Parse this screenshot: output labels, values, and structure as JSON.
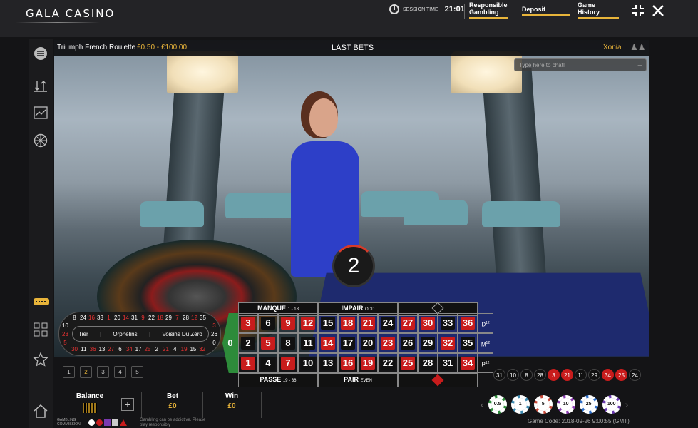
{
  "header": {
    "logo": "GALA CASINO",
    "session_label": "SESSION TIME",
    "session_time": "21:01",
    "links": [
      {
        "line1": "Responsible",
        "line2": "Gambling"
      },
      {
        "line1": "Deposit",
        "line2": ""
      },
      {
        "line1": "Game",
        "line2": "History"
      }
    ],
    "icons": [
      "fullscreen-icon",
      "close-icon"
    ]
  },
  "sidebar": {
    "icons": [
      "menu-icon",
      "sort-icon",
      "chart-icon",
      "wheel-icon",
      "chip-stack-icon",
      "grid-icon",
      "star-icon",
      "home-icon"
    ]
  },
  "stage": {
    "game_name": "Triumph French Roulette",
    "limits": "£0.50 - £100.00",
    "last_bets": "LAST BETS",
    "dealer_name": "Xonia",
    "chat_placeholder": "Type here to chat!",
    "timer": "2"
  },
  "racetrack": {
    "top": [
      "8",
      "24",
      "16",
      "33",
      "1",
      "20",
      "14",
      "31",
      "9",
      "22",
      "18",
      "29",
      "7",
      "28",
      "12",
      "35"
    ],
    "bottom": [
      "30",
      "11",
      "36",
      "13",
      "27",
      "6",
      "34",
      "17",
      "25",
      "2",
      "21",
      "4",
      "19",
      "15",
      "32"
    ],
    "left": [
      "10",
      "23",
      "5"
    ],
    "right": [
      "3",
      "26",
      "0"
    ],
    "sections": [
      "Tier",
      "Orphelins",
      "Voisins Du Zero"
    ]
  },
  "recent_buttons": [
    "1",
    "2",
    "3",
    "4",
    "5"
  ],
  "betting_table": {
    "zero": "0",
    "top": [
      {
        "main": "MANQUE",
        "sub": "1 - 18"
      },
      {
        "main": "IMPAIR",
        "sub": "ODD"
      },
      {
        "main": "",
        "sub": ""
      }
    ],
    "bottom": [
      {
        "main": "PASSE",
        "sub": "19 - 36"
      },
      {
        "main": "PAIR",
        "sub": "EVEN"
      },
      {
        "main": "",
        "sub": ""
      }
    ],
    "rows": [
      [
        {
          "n": "3",
          "c": "red"
        },
        {
          "n": "6",
          "c": "black"
        },
        {
          "n": "9",
          "c": "red"
        },
        {
          "n": "12",
          "c": "red"
        },
        {
          "n": "15",
          "c": "black"
        },
        {
          "n": "18",
          "c": "red"
        },
        {
          "n": "21",
          "c": "red"
        },
        {
          "n": "24",
          "c": "black"
        },
        {
          "n": "27",
          "c": "red"
        },
        {
          "n": "30",
          "c": "red"
        },
        {
          "n": "33",
          "c": "black"
        },
        {
          "n": "36",
          "c": "red"
        }
      ],
      [
        {
          "n": "2",
          "c": "black"
        },
        {
          "n": "5",
          "c": "red"
        },
        {
          "n": "8",
          "c": "black"
        },
        {
          "n": "11",
          "c": "black"
        },
        {
          "n": "14",
          "c": "red"
        },
        {
          "n": "17",
          "c": "black"
        },
        {
          "n": "20",
          "c": "black"
        },
        {
          "n": "23",
          "c": "red"
        },
        {
          "n": "26",
          "c": "black"
        },
        {
          "n": "29",
          "c": "black"
        },
        {
          "n": "32",
          "c": "red"
        },
        {
          "n": "35",
          "c": "black"
        }
      ],
      [
        {
          "n": "1",
          "c": "red"
        },
        {
          "n": "4",
          "c": "black"
        },
        {
          "n": "7",
          "c": "red"
        },
        {
          "n": "10",
          "c": "black"
        },
        {
          "n": "13",
          "c": "black"
        },
        {
          "n": "16",
          "c": "red"
        },
        {
          "n": "19",
          "c": "red"
        },
        {
          "n": "22",
          "c": "black"
        },
        {
          "n": "25",
          "c": "red"
        },
        {
          "n": "28",
          "c": "black"
        },
        {
          "n": "31",
          "c": "black"
        },
        {
          "n": "34",
          "c": "red"
        }
      ]
    ],
    "columns": [
      {
        "main": "D",
        "sup": "12"
      },
      {
        "main": "M",
        "sup": "12"
      },
      {
        "main": "P",
        "sup": "12"
      }
    ]
  },
  "history": [
    {
      "n": "31",
      "c": "black"
    },
    {
      "n": "10",
      "c": "black"
    },
    {
      "n": "8",
      "c": "black"
    },
    {
      "n": "28",
      "c": "black"
    },
    {
      "n": "3",
      "c": "red"
    },
    {
      "n": "21",
      "c": "red"
    },
    {
      "n": "11",
      "c": "black"
    },
    {
      "n": "29",
      "c": "black"
    },
    {
      "n": "34",
      "c": "red"
    },
    {
      "n": "25",
      "c": "red"
    },
    {
      "n": "24",
      "c": "black"
    }
  ],
  "footer": {
    "balance_label": "Balance",
    "bet_label": "Bet",
    "bet_value": "£0",
    "win_label": "Win",
    "win_value": "£0",
    "gambling_line1": "GAMBLING",
    "gambling_line2": "COMMISSION",
    "addictive_line1": "Gambling can be addictive. Please",
    "addictive_line2": "play responsibly",
    "chips": [
      {
        "label": "0.5",
        "color": "#2d8b3a"
      },
      {
        "label": "1",
        "color": "#3d8ab0"
      },
      {
        "label": "5",
        "color": "#c84a3a"
      },
      {
        "label": "10",
        "color": "#8a3ab0"
      },
      {
        "label": "25",
        "color": "#2d6ec8"
      },
      {
        "label": "100",
        "color": "#6a3ab0"
      }
    ],
    "game_code": "Game Code: 2018-09-26 9:00:55 (GMT)"
  },
  "colors": {
    "accent": "#e8b43a",
    "red": "#c81c1c",
    "green": "#2d8b3a"
  }
}
